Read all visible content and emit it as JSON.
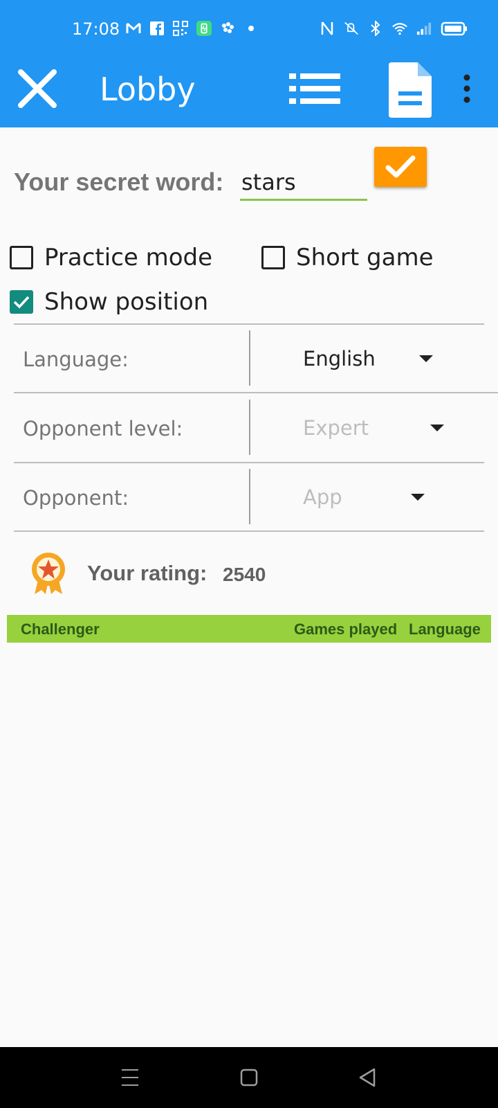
{
  "status_bar": {
    "time": "17:08",
    "left_icons": [
      "gmail-icon",
      "facebook-icon",
      "qr-code-icon",
      "battery-saver-icon",
      "app-icon",
      "dot-icon"
    ],
    "right_icons": [
      "nfc-icon",
      "mute-icon",
      "bluetooth-icon",
      "wifi-icon",
      "signal-icon",
      "battery-icon"
    ]
  },
  "app_bar": {
    "title": "Lobby",
    "background": "#2196f3",
    "actions": [
      "close-icon",
      "list-icon",
      "document-icon",
      "more-vert-icon"
    ]
  },
  "secret_word": {
    "label": "Your secret word:",
    "value": "stars",
    "underline_color": "#8bc34a",
    "confirm_color": "#ff9800"
  },
  "options": {
    "practice_mode": {
      "label": "Practice mode",
      "checked": false
    },
    "short_game": {
      "label": "Short game",
      "checked": false
    },
    "show_position": {
      "label": "Show position",
      "checked": true
    }
  },
  "settings": {
    "language": {
      "label": "Language:",
      "value": "English",
      "enabled": true
    },
    "opponent_level": {
      "label": "Opponent level:",
      "value": "Expert",
      "enabled": false
    },
    "opponent": {
      "label": "Opponent:",
      "value": "App",
      "enabled": false
    }
  },
  "rating": {
    "label": "Your rating:",
    "value": "2540",
    "icon": "badge-star-icon"
  },
  "players_table": {
    "header_color": "#97d13e",
    "columns": [
      "Challenger",
      "Games played",
      "Language"
    ],
    "rows": []
  },
  "nav_bar": {
    "buttons": [
      "menu-icon",
      "home-icon",
      "back-icon"
    ]
  }
}
